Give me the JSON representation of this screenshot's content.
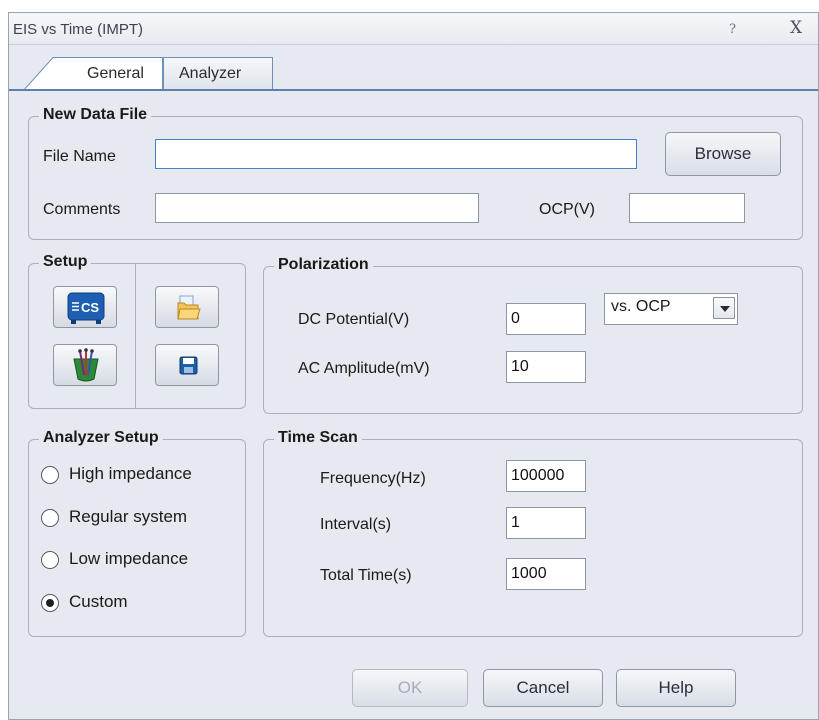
{
  "window": {
    "title": "EIS vs Time (IMPT)",
    "help_glyph": "?",
    "close_glyph": "X"
  },
  "tabs": [
    {
      "label": "General",
      "active": true
    },
    {
      "label": "Analyzer",
      "active": false
    }
  ],
  "new_data_file": {
    "title": "New Data File",
    "file_name_label": "File Name",
    "file_name_value": "",
    "browse_label": "Browse",
    "comments_label": "Comments",
    "comments_value": "",
    "ocp_label": "OCP(V)",
    "ocp_value": ""
  },
  "setup": {
    "title": "Setup",
    "icons": [
      "cs-instrument-icon",
      "open-folder-icon",
      "electrode-cell-icon",
      "save-disk-icon"
    ]
  },
  "polarization": {
    "title": "Polarization",
    "dc_label": "DC Potential(V)",
    "dc_value": "0",
    "ref_selected": "vs. OCP",
    "ac_label": "AC Amplitude(mV)",
    "ac_value": "10"
  },
  "analyzer_setup": {
    "title": "Analyzer Setup",
    "options": [
      {
        "label": "High impedance",
        "checked": false
      },
      {
        "label": "Regular system",
        "checked": false
      },
      {
        "label": "Low impedance",
        "checked": false
      },
      {
        "label": "Custom",
        "checked": true
      }
    ]
  },
  "time_scan": {
    "title": "Time Scan",
    "freq_label": "Frequency(Hz)",
    "freq_value": "100000",
    "interval_label": "Interval(s)",
    "interval_value": "1",
    "total_label": "Total Time(s)",
    "total_value": "1000"
  },
  "buttons": {
    "ok": "OK",
    "cancel": "Cancel",
    "help": "Help"
  },
  "colors": {
    "window_bg": "#e6e9ef",
    "focus_border": "#3f83c8",
    "tab_accent": "#5b7fae",
    "cs_icon_blue": "#1e5fb4"
  }
}
